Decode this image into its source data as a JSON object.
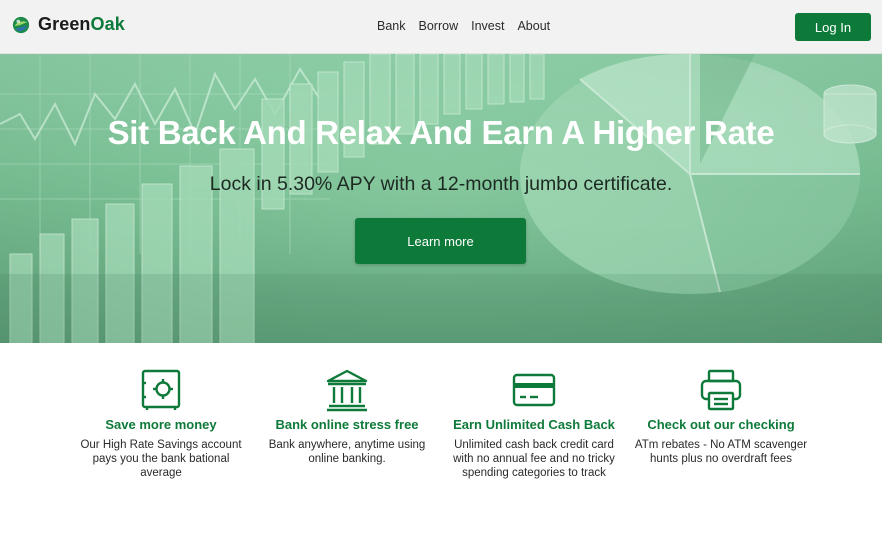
{
  "header": {
    "brand_part1": "Green",
    "brand_part2": "Oak",
    "nav": [
      "Bank",
      "Borrow",
      "Invest",
      "About"
    ],
    "login_label": "Log In"
  },
  "hero": {
    "title": "Sit Back And Relax And Earn A Higher Rate",
    "subtitle": "Lock in 5.30% APY with a 12-month jumbo certificate.",
    "cta_label": "Learn more"
  },
  "features": [
    {
      "icon": "safe-icon",
      "title": "Save more money",
      "description": "Our High Rate Savings account pays you the bank bational average"
    },
    {
      "icon": "bank-building-icon",
      "title": "Bank online stress free",
      "description": "Bank anywhere, anytime using online banking."
    },
    {
      "icon": "credit-card-icon",
      "title": "Earn Unlimited Cash Back",
      "description": "Unlimited cash back credit card with no annual fee and no tricky spending categories to track"
    },
    {
      "icon": "printer-icon",
      "title": "Check out our checking",
      "description": "ATm rebates - No ATM scavenger hunts plus no overdraft fees"
    }
  ],
  "colors": {
    "brand_green": "#0e7a3a",
    "header_bg": "#f2f2f2",
    "hero_tint": "#78bd92"
  }
}
